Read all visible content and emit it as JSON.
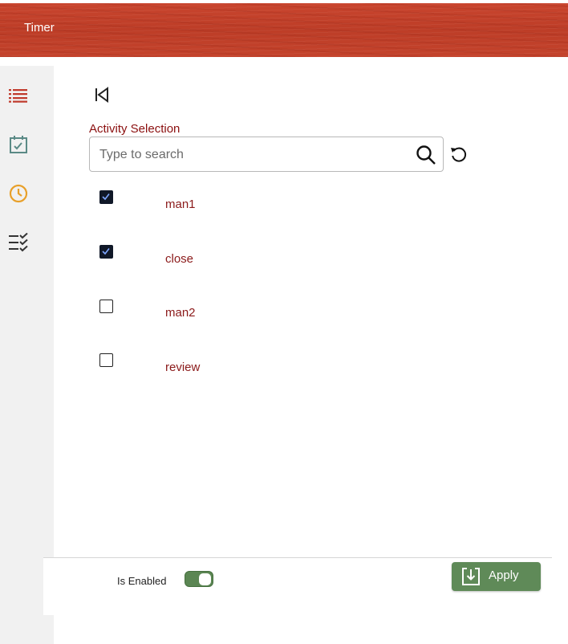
{
  "header": {
    "title": "Timer"
  },
  "sidebar": {
    "items": [
      {
        "icon": "list-icon",
        "color": "#c0392b"
      },
      {
        "icon": "calendar-check-icon",
        "color": "#5b8a86"
      },
      {
        "icon": "clock-icon",
        "color": "#e8a02a"
      },
      {
        "icon": "checklist-icon",
        "color": "#333333"
      }
    ]
  },
  "main": {
    "section_label": "Activity Selection",
    "search": {
      "placeholder": "Type to search",
      "value": ""
    },
    "activities": [
      {
        "label": "man1",
        "checked": true
      },
      {
        "label": "close",
        "checked": true
      },
      {
        "label": "man2",
        "checked": false
      },
      {
        "label": "review",
        "checked": false
      }
    ]
  },
  "footer": {
    "enabled_label": "Is Enabled",
    "enabled": true,
    "apply_label": "Apply"
  },
  "colors": {
    "brand_header": "#c4432c",
    "accent_text": "#8b0f0f",
    "apply_green": "#5f8a58"
  }
}
